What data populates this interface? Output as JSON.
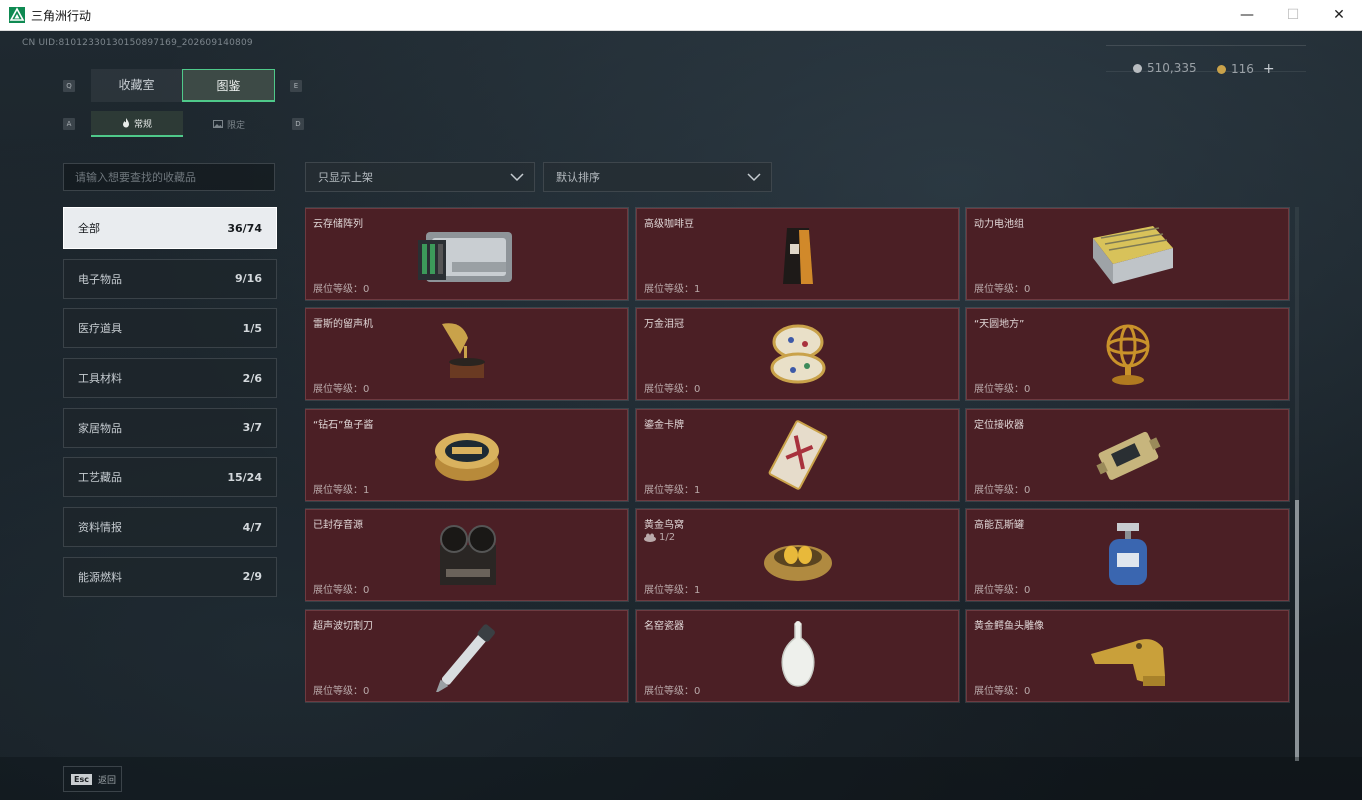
{
  "window": {
    "title": "三角洲行动",
    "minimize_glyph": "—",
    "maximize_glyph": "☐",
    "close_glyph": "✕"
  },
  "header": {
    "uid": "CN UID:81012330130150897169_202609140809"
  },
  "currency": {
    "silver": "510,335",
    "gold": "116",
    "add": "+"
  },
  "hotkeys": {
    "prev_tab": "Q",
    "next_tab": "E",
    "prev_sub": "A",
    "next_sub": "D"
  },
  "tabs": {
    "collection_room": "收藏室",
    "codex": "图鉴"
  },
  "subtabs": {
    "normal": "常规",
    "limited": "限定"
  },
  "search": {
    "placeholder": "请输入想要查找的收藏品"
  },
  "filters": {
    "show": "只显示上架",
    "sort": "默认排序"
  },
  "categories": [
    {
      "label": "全部",
      "count": "36/74"
    },
    {
      "label": "电子物品",
      "count": "9/16"
    },
    {
      "label": "医疗道具",
      "count": "1/5"
    },
    {
      "label": "工具材料",
      "count": "2/6"
    },
    {
      "label": "家居物品",
      "count": "3/7"
    },
    {
      "label": "工艺藏品",
      "count": "15/24"
    },
    {
      "label": "资料情报",
      "count": "4/7"
    },
    {
      "label": "能源燃料",
      "count": "2/9"
    }
  ],
  "items": [
    {
      "name": "",
      "level": "展位等级：0",
      "icon": "partial-item-icon"
    },
    {
      "name": "",
      "level": "展位等级：1",
      "icon": "partial-item-icon"
    },
    {
      "name": "",
      "level": "展位等级：0",
      "icon": "partial-item-icon"
    },
    {
      "name": "云存储阵列",
      "level": "展位等级：0",
      "icon": "server-array-icon"
    },
    {
      "name": "高级咖啡豆",
      "level": "展位等级：1",
      "icon": "coffee-bag-icon"
    },
    {
      "name": "动力电池组",
      "level": "展位等级：0",
      "icon": "battery-pack-icon"
    },
    {
      "name": "雷斯的留声机",
      "level": "展位等级：0",
      "icon": "gramophone-icon"
    },
    {
      "name": "万金泪冠",
      "level": "展位等级：0",
      "icon": "jeweled-egg-icon"
    },
    {
      "name": "“天圆地方”",
      "level": "展位等级：0",
      "icon": "armillary-sphere-icon"
    },
    {
      "name": "“钻石”鱼子酱",
      "level": "展位等级：1",
      "icon": "caviar-tin-icon"
    },
    {
      "name": "鎏金卡牌",
      "level": "展位等级：1",
      "icon": "gilded-card-icon"
    },
    {
      "name": "定位接收器",
      "level": "展位等级：0",
      "icon": "gps-receiver-icon"
    },
    {
      "name": "已封存音源",
      "level": "展位等级：0",
      "icon": "reel-recorder-icon"
    },
    {
      "name": "黄金鸟窝",
      "level": "展位等级：1",
      "icon": "golden-nest-icon",
      "sub": "1/2"
    },
    {
      "name": "高能瓦斯罐",
      "level": "展位等级：0",
      "icon": "gas-canister-icon"
    },
    {
      "name": "超声波切割刀",
      "level": "展位等级：0",
      "icon": "ultrasonic-knife-icon"
    },
    {
      "name": "名窑瓷器",
      "level": "展位等级：0",
      "icon": "porcelain-vase-icon"
    },
    {
      "name": "黄金鳄鱼头雕像",
      "level": "展位等级：0",
      "icon": "gold-crocodile-icon"
    }
  ],
  "footer": {
    "esc_key": "Esc",
    "back": "返回"
  },
  "colors": {
    "accent": "#4fc98a",
    "card_bg": "#4b1f25",
    "card_border": "#6d3a40"
  }
}
